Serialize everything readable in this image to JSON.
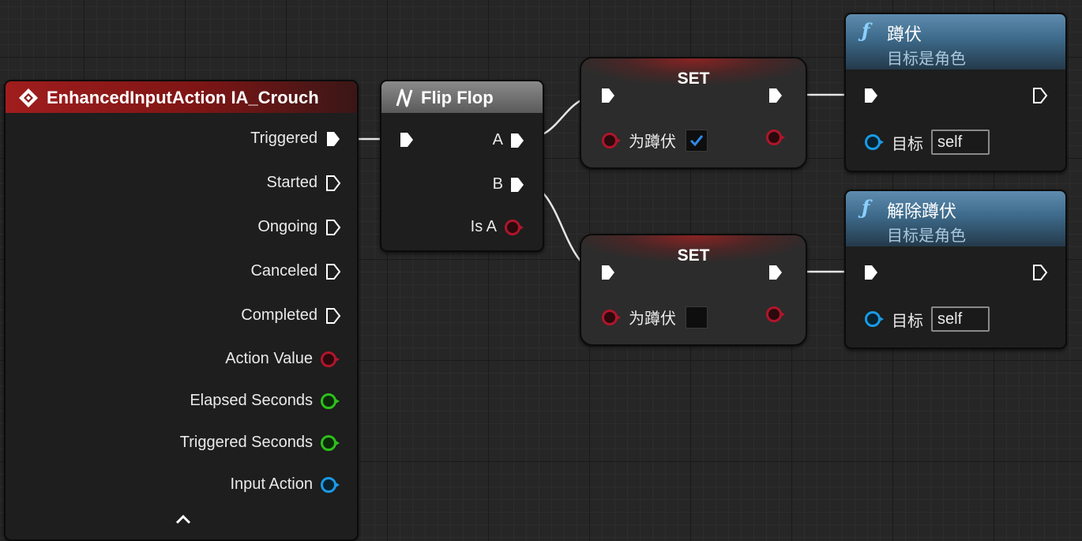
{
  "event_node": {
    "title": "EnhancedInputAction IA_Crouch",
    "pins": [
      {
        "label": "Triggered",
        "type": "exec",
        "connected": true
      },
      {
        "label": "Started",
        "type": "exec",
        "connected": false
      },
      {
        "label": "Ongoing",
        "type": "exec",
        "connected": false
      },
      {
        "label": "Canceled",
        "type": "exec",
        "connected": false
      },
      {
        "label": "Completed",
        "type": "exec",
        "connected": false
      },
      {
        "label": "Action Value",
        "type": "struct"
      },
      {
        "label": "Elapsed Seconds",
        "type": "float"
      },
      {
        "label": "Triggered Seconds",
        "type": "float"
      },
      {
        "label": "Input Action",
        "type": "object"
      }
    ],
    "collapse_icon": "chevron-up-icon"
  },
  "flipflop_node": {
    "title": "Flip Flop",
    "outputs": {
      "a": "A",
      "b": "B",
      "is_a": "Is A"
    }
  },
  "set_node_1": {
    "title": "SET",
    "var_label": "为蹲伏",
    "checked": true
  },
  "set_node_2": {
    "title": "SET",
    "var_label": "为蹲伏",
    "checked": false
  },
  "func_node_1": {
    "title": "蹲伏",
    "subtitle": "目标是角色",
    "target_label": "目标",
    "target_value": "self"
  },
  "func_node_2": {
    "title": "解除蹲伏",
    "subtitle": "目标是角色",
    "target_label": "目标",
    "target_value": "self"
  },
  "colors": {
    "event_header": "#8b1a1a",
    "set_header": "#7a2a2a",
    "function_header": "#3d6a8a",
    "bool_pin": "#b0152b",
    "float_pin": "#2fbf1d",
    "object_pin": "#1a9ae6",
    "subtitle": "#a8c8dc"
  }
}
